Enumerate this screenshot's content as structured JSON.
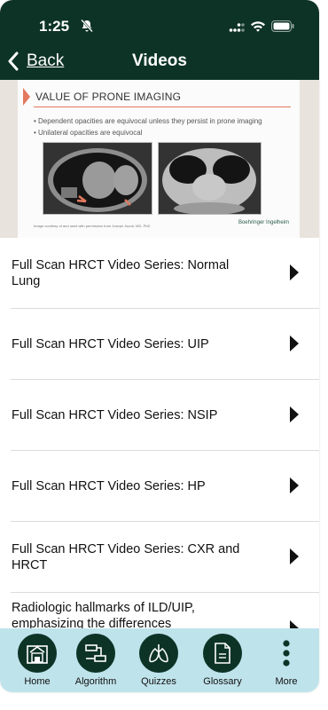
{
  "status": {
    "time": "1:25"
  },
  "nav": {
    "back_label": "Back",
    "title": "Videos"
  },
  "hero": {
    "slide_title": "VALUE OF PRONE IMAGING",
    "bullets": [
      "Dependent opacities are equivocal unless they persist in prone imaging",
      "Unilateral opacities are equivocal"
    ],
    "caption": "Image courtesy of and used with permission from Joseph Jacob, MD, PhD",
    "logo": "Boehringer Ingelheim"
  },
  "videos": [
    {
      "label": "Full Scan HRCT Video Series: Normal Lung"
    },
    {
      "label": "Full Scan HRCT Video Series: UIP"
    },
    {
      "label": "Full Scan HRCT Video Series: NSIP"
    },
    {
      "label": "Full Scan HRCT Video Series: HP"
    },
    {
      "label": "Full Scan HRCT Video Series: CXR and HRCT"
    },
    {
      "label": "Radiologic hallmarks of ILD/UIP, emphasizing the differences"
    }
  ],
  "tabs": [
    {
      "label": "Home",
      "icon": "home-icon"
    },
    {
      "label": "Algorithm",
      "icon": "algorithm-icon"
    },
    {
      "label": "Quizzes",
      "icon": "lungs-icon"
    },
    {
      "label": "Glossary",
      "icon": "document-icon"
    },
    {
      "label": "More",
      "icon": "more-icon"
    }
  ],
  "colors": {
    "header": "#0d3327",
    "tabbar": "#bfe3eb",
    "accent": "#e3795f"
  }
}
